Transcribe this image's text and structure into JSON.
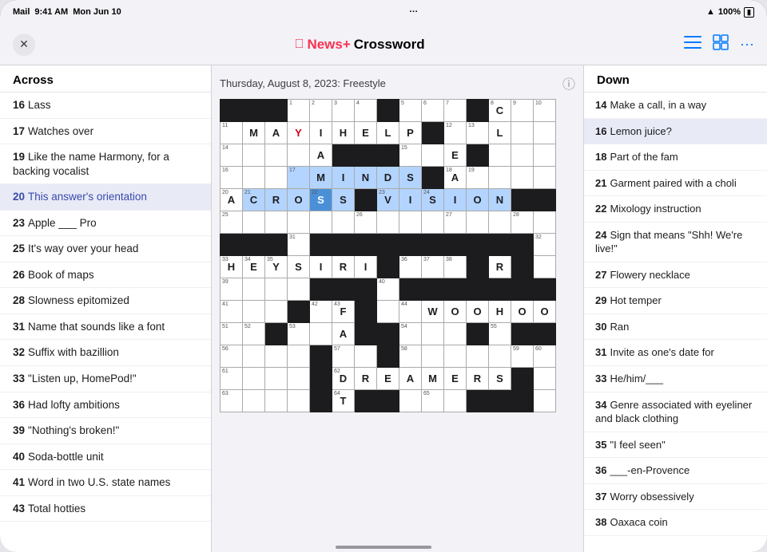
{
  "status_bar": {
    "left": "Mail",
    "time": "9:41 AM",
    "date": "Mon Jun 10",
    "dots": "···",
    "wifi": "WiFi",
    "battery": "100%"
  },
  "nav": {
    "close_label": "✕",
    "title_news": "News+",
    "title_crossword": " Crossword",
    "icon_list": "≡",
    "icon_grid": "⊞",
    "icon_more": "···"
  },
  "grid_header": {
    "date": "Thursday, August 8, 2023: Freestyle",
    "info": "ℹ"
  },
  "across_header": "Across",
  "down_header": "Down",
  "across_clues": [
    {
      "num": "16",
      "text": "Lass"
    },
    {
      "num": "17",
      "text": "Watches over"
    },
    {
      "num": "19",
      "text": "Like the name Harmony, for a backing vocalist"
    },
    {
      "num": "20",
      "text": "This answer's orientation",
      "active": true
    },
    {
      "num": "23",
      "text": "Apple ___ Pro"
    },
    {
      "num": "25",
      "text": "It's way over your head"
    },
    {
      "num": "26",
      "text": "Book of maps"
    },
    {
      "num": "28",
      "text": "Slowness epitomized"
    },
    {
      "num": "31",
      "text": "Name that sounds like a font"
    },
    {
      "num": "32",
      "text": "Suffix with bazillion"
    },
    {
      "num": "33",
      "text": "\"Listen up, HomePod!\""
    },
    {
      "num": "36",
      "text": "Had lofty ambitions"
    },
    {
      "num": "39",
      "text": "\"Nothing's broken!\""
    },
    {
      "num": "40",
      "text": "Soda-bottle unit"
    },
    {
      "num": "41",
      "text": "Word in two U.S. state names"
    },
    {
      "num": "43",
      "text": "Total hotties"
    }
  ],
  "down_clues": [
    {
      "num": "14",
      "text": "Make a call, in a way"
    },
    {
      "num": "16",
      "text": "Lemon juice?",
      "active": true
    },
    {
      "num": "18",
      "text": "Part of the fam"
    },
    {
      "num": "21",
      "text": "Garment paired with a choli"
    },
    {
      "num": "22",
      "text": "Mixology instruction"
    },
    {
      "num": "24",
      "text": "Sign that means \"Shh! We're live!\""
    },
    {
      "num": "27",
      "text": "Flowery necklace"
    },
    {
      "num": "29",
      "text": "Hot temper"
    },
    {
      "num": "30",
      "text": "Ran"
    },
    {
      "num": "31",
      "text": "Invite as one's date for"
    },
    {
      "num": "33",
      "text": "He/him/___"
    },
    {
      "num": "34",
      "text": "Genre associated with eyeliner and black clothing"
    },
    {
      "num": "35",
      "text": "\"I feel seen\""
    },
    {
      "num": "36",
      "text": "___-en-Provence"
    },
    {
      "num": "37",
      "text": "Worry obsessively"
    },
    {
      "num": "38",
      "text": "Oaxaca coin"
    }
  ],
  "colors": {
    "accent": "#007aff",
    "apple_red": "#fa3253",
    "active_bg": "#e8eaf6",
    "active_text": "#3949ab",
    "black_cell": "#1c1c1e",
    "highlighted_cell": "#b3d4ff",
    "selected_cell": "#4a90d9"
  }
}
